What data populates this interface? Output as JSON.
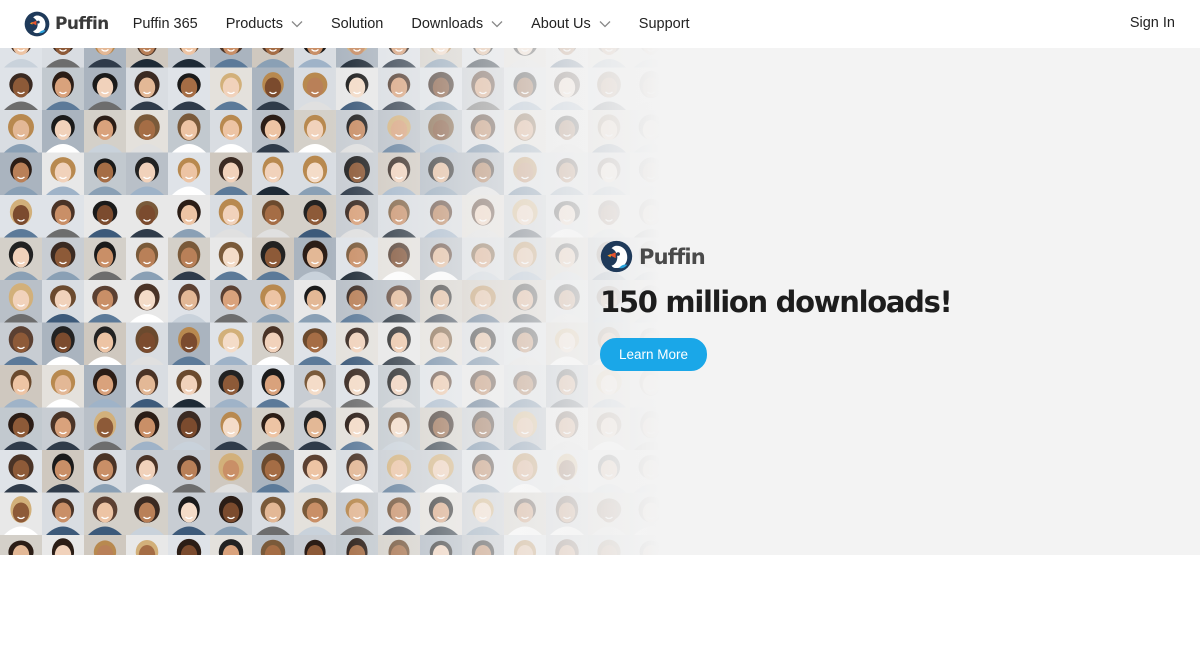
{
  "nav": {
    "brand": "Puffin",
    "items": [
      {
        "label": "Puffin 365",
        "dropdown": false
      },
      {
        "label": "Products",
        "dropdown": true
      },
      {
        "label": "Solution",
        "dropdown": false
      },
      {
        "label": "Downloads",
        "dropdown": true
      },
      {
        "label": "About Us",
        "dropdown": true
      },
      {
        "label": "Support",
        "dropdown": false
      }
    ],
    "signin": "Sign In"
  },
  "hero": {
    "brand": "Puffin",
    "headline": "150 million downloads!",
    "cta": "Learn More",
    "mosaic_description_icon": "portrait-grid-image"
  },
  "colors": {
    "accent": "#1aa7e8",
    "hero_bg": "#f3f3f3",
    "text": "#222222"
  }
}
